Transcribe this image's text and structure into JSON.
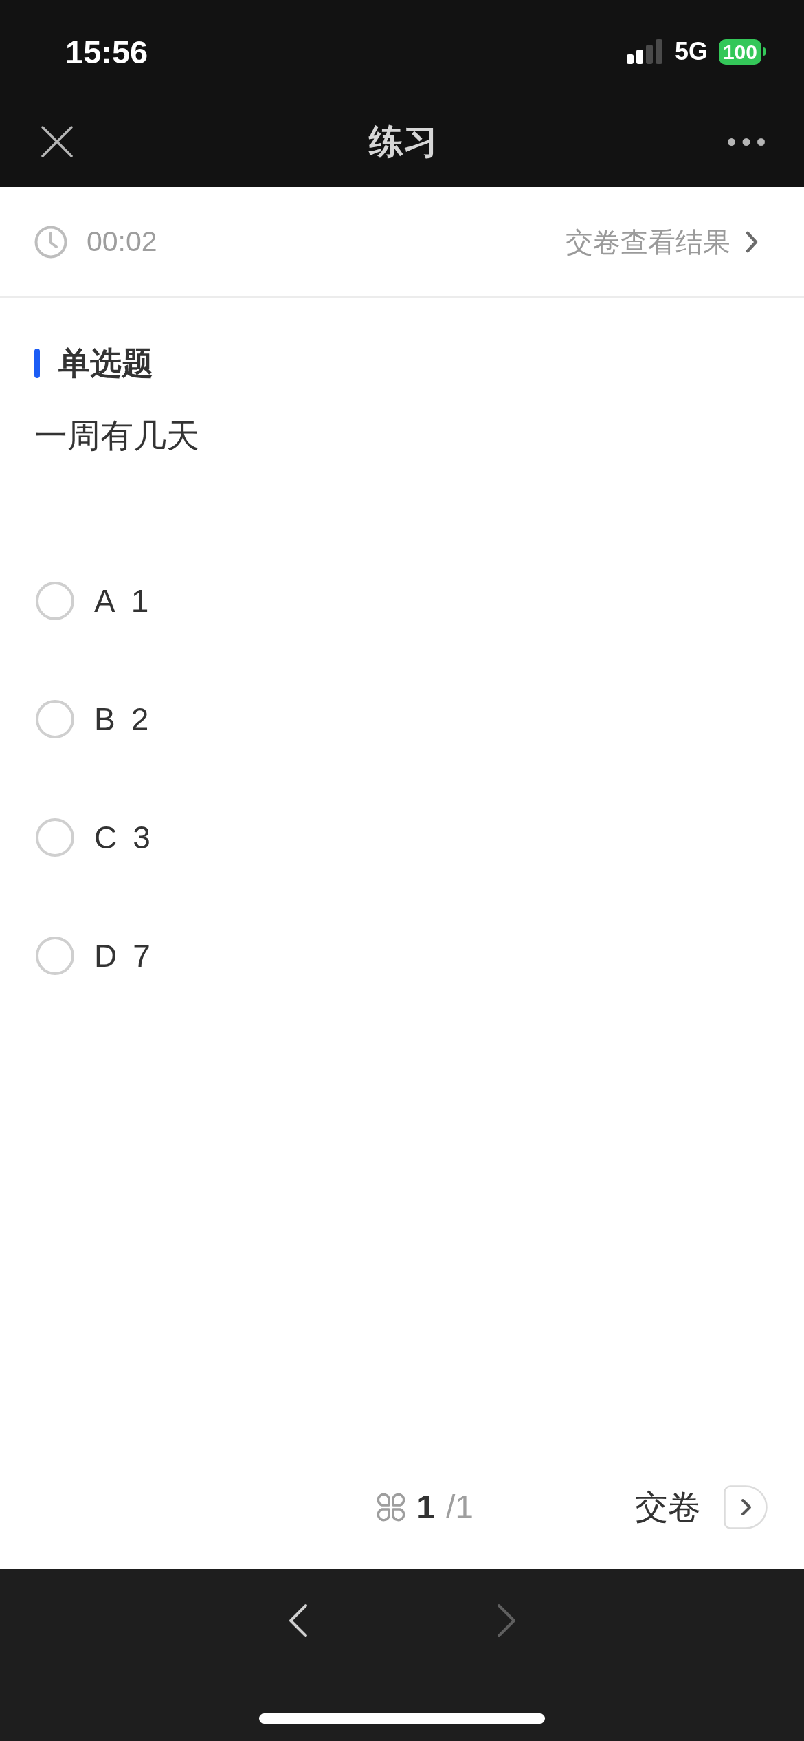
{
  "status_bar": {
    "time": "15:56",
    "network": "5G",
    "battery": "100"
  },
  "nav_bar": {
    "title": "练习"
  },
  "timer_bar": {
    "elapsed": "00:02",
    "submit_link": "交卷查看结果"
  },
  "question": {
    "type_label": "单选题",
    "text": "一周有几天",
    "options": [
      {
        "letter": "A",
        "text": "1",
        "selected": false
      },
      {
        "letter": "B",
        "text": "2",
        "selected": false
      },
      {
        "letter": "C",
        "text": "3",
        "selected": false
      },
      {
        "letter": "D",
        "text": "7",
        "selected": false
      }
    ]
  },
  "footer": {
    "current": "1",
    "total": "/1",
    "submit": "交卷"
  },
  "browser_bar": {
    "back": {
      "disabled": false
    },
    "forward": {
      "disabled": true
    }
  }
}
